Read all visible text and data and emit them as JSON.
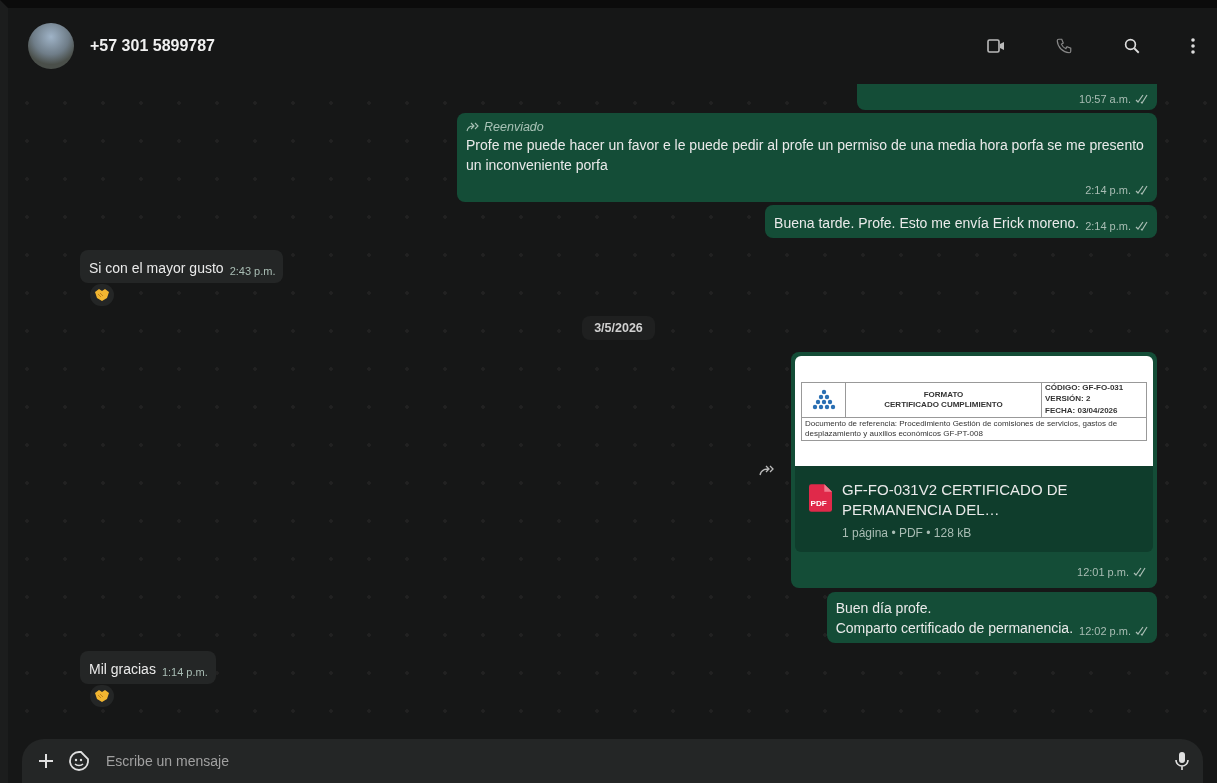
{
  "header": {
    "contact_name": "+57 301 5899787"
  },
  "messages": [
    {
      "kind": "clipped",
      "outgoing": true,
      "time": "10:57 a.m.",
      "read": true
    },
    {
      "kind": "text",
      "outgoing": true,
      "forwarded": true,
      "forwarded_label": "Reenviado",
      "text": "Profe me puede hacer un favor e le puede pedir al profe un permiso de una media hora porfa se me presento un inconveniente porfa",
      "time": "2:14 p.m.",
      "read": true
    },
    {
      "kind": "text",
      "outgoing": true,
      "forwarded": false,
      "text": "Buena tarde. Profe. Esto me envía Erick moreno.",
      "time": "2:14 p.m.",
      "read": true
    },
    {
      "kind": "text",
      "outgoing": false,
      "forwarded": false,
      "text": "Si con el mayor gusto",
      "time": "2:43 p.m.",
      "reaction": true
    },
    {
      "kind": "date",
      "text": "3/5/2026"
    },
    {
      "kind": "document",
      "outgoing": true,
      "preview": {
        "title": "FORMATO",
        "subtitle": "CERTIFICADO CUMPLIMIENTO",
        "code": "CÓDIGO: GF-FO-031",
        "version": "VERSIÓN: 2",
        "date": "FECHA: 03/04/2026",
        "reference": "Documento de referencia: Procedimiento Gestión de comisiones de servicios, gastos de desplazamiento y auxilios económicos GF-PT-008"
      },
      "file_type": "PDF",
      "file_name": "GF-FO-031V2 CERTIFICADO DE PERMANENCIA DEL…",
      "file_meta": "1 página • PDF • 128 kB",
      "time": "12:01 p.m.",
      "read": true
    },
    {
      "kind": "text",
      "outgoing": true,
      "forwarded": false,
      "text": "Buen día profe.\nComparto certificado de permanencia.",
      "time": "12:02 p.m.",
      "read": true
    },
    {
      "kind": "text",
      "outgoing": false,
      "forwarded": false,
      "text": "Mil gracias",
      "time": "1:14 p.m.",
      "reaction": true
    }
  ],
  "composer": {
    "placeholder": "Escribe un mensaje"
  }
}
